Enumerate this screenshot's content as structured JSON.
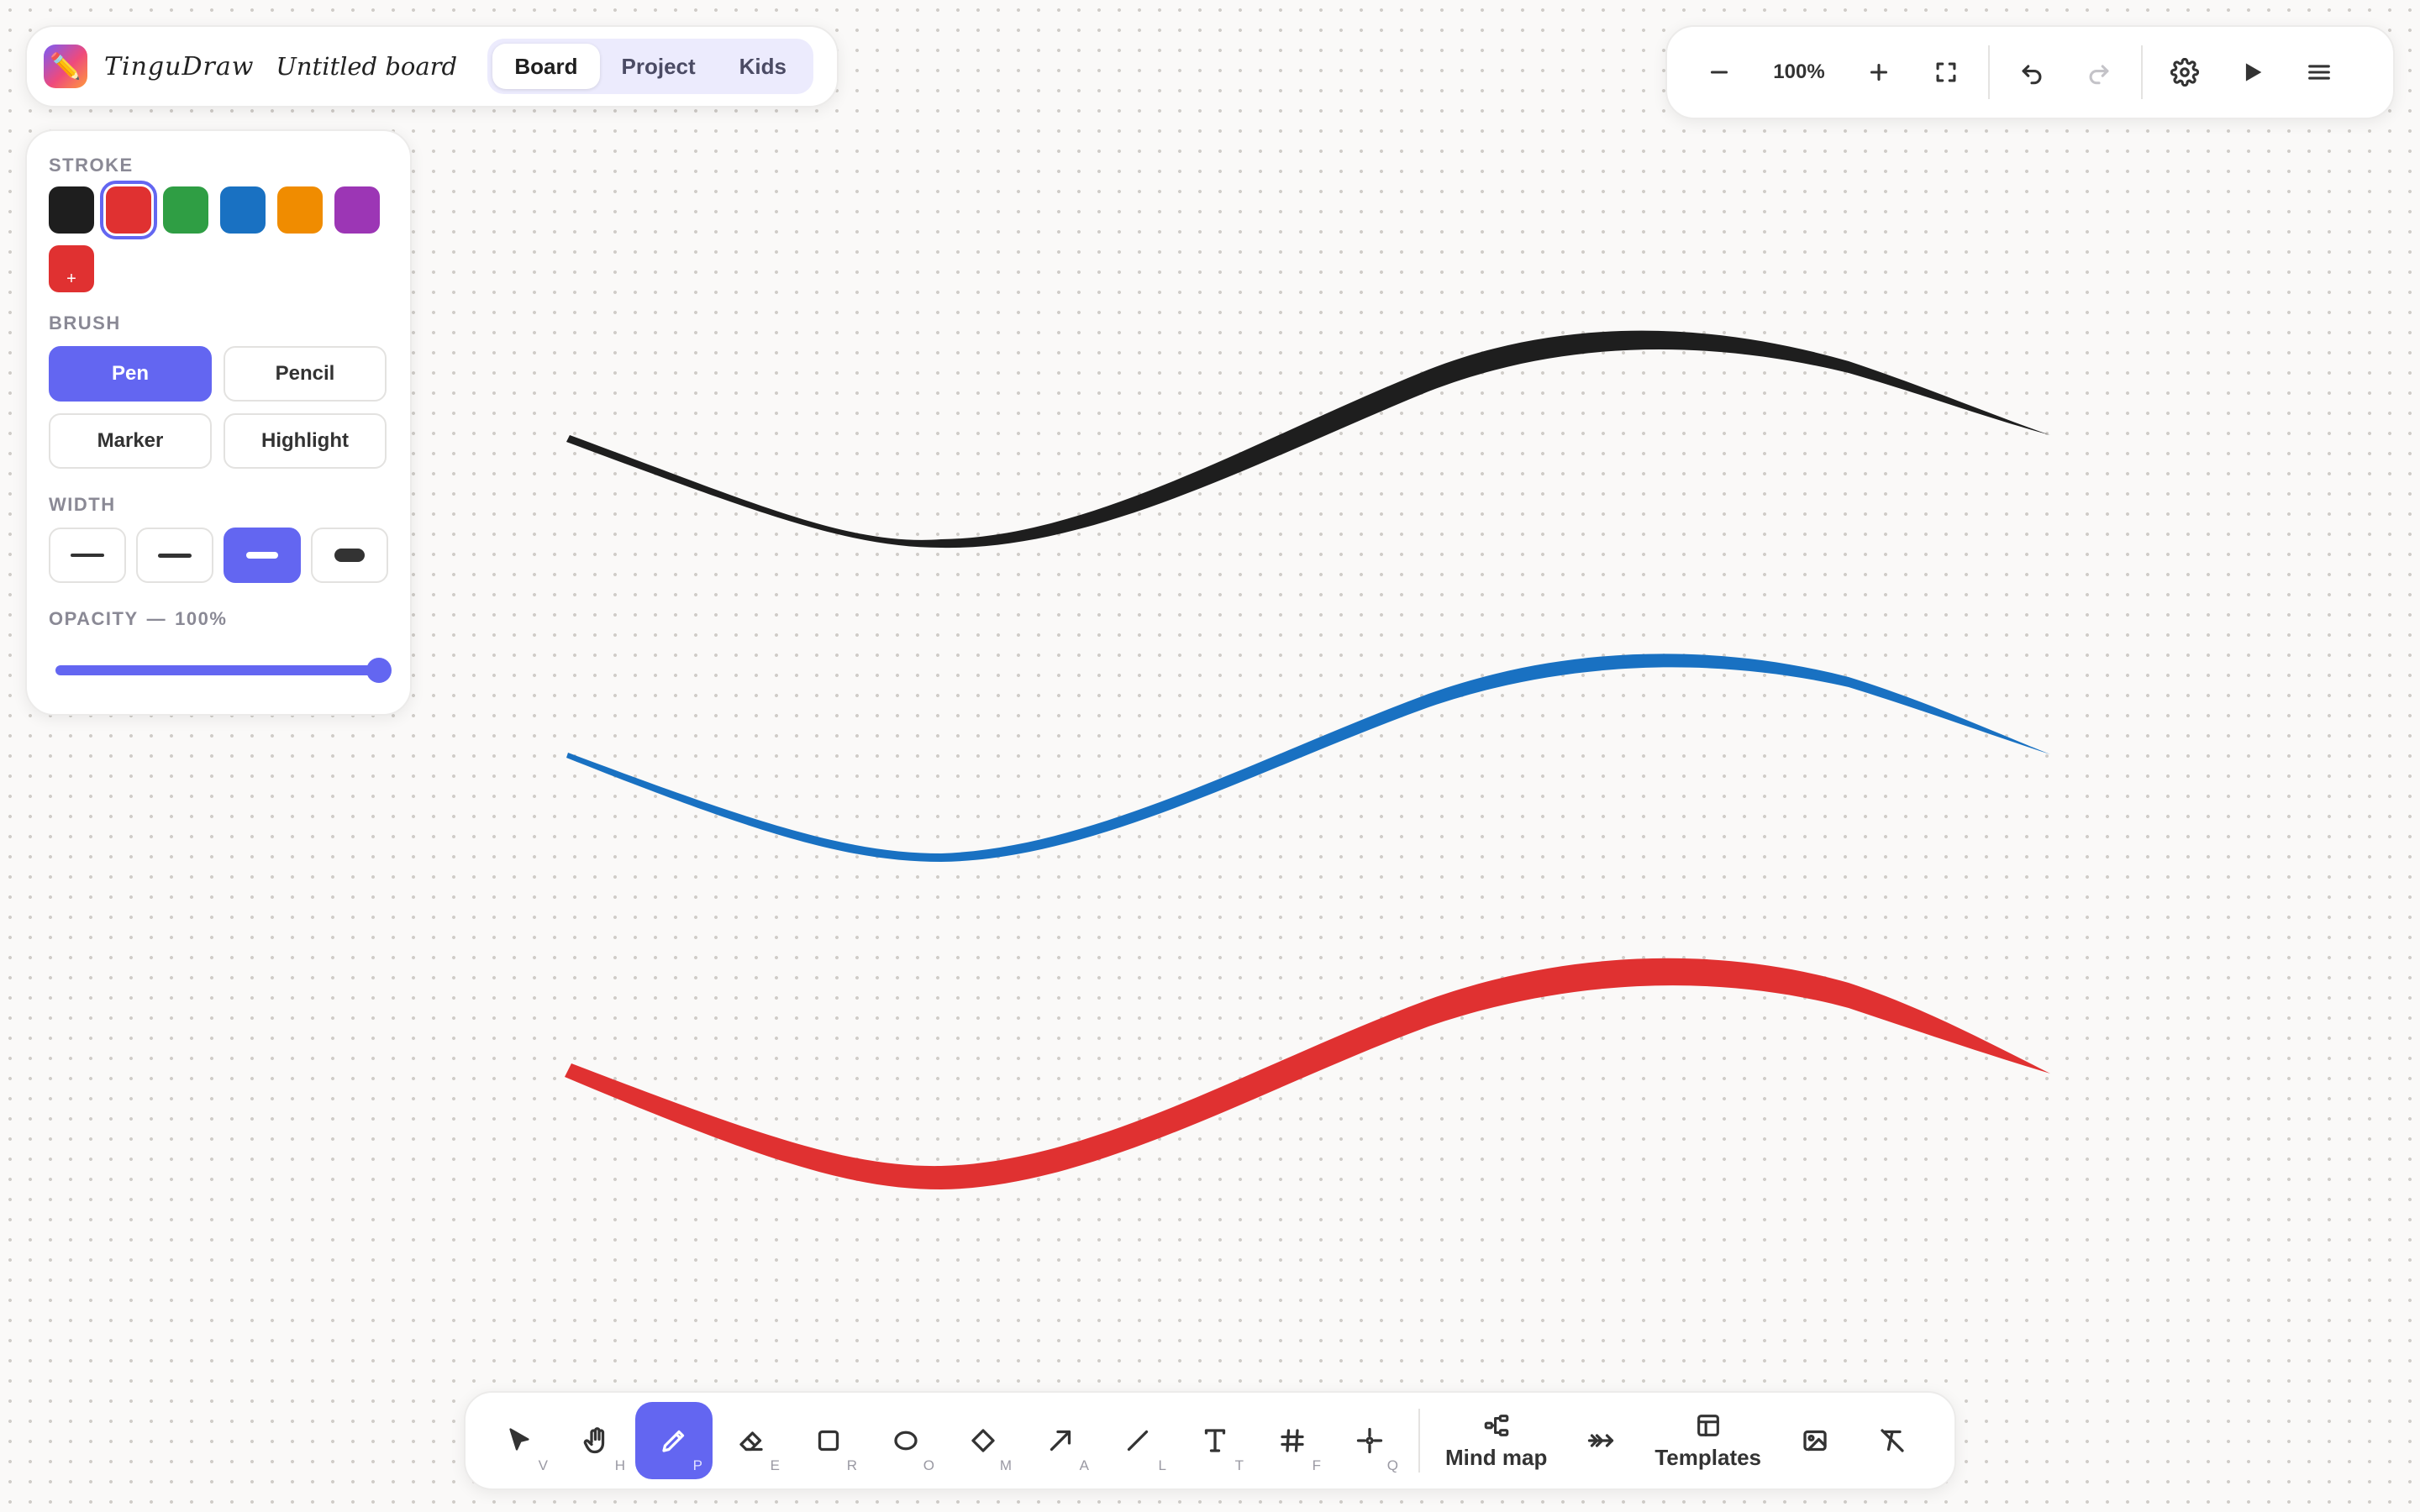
{
  "app": {
    "name": "TinguDraw",
    "board_name": "Untitled board",
    "logo_glyph": "✏️"
  },
  "mode_tabs": [
    {
      "label": "Board",
      "active": true
    },
    {
      "label": "Project",
      "active": false
    },
    {
      "label": "Kids",
      "active": false
    }
  ],
  "top_right": {
    "zoom": "100%"
  },
  "style_panel": {
    "stroke_label": "STROKE",
    "swatches": [
      {
        "color": "#1e1e1e"
      },
      {
        "color": "#e03131",
        "selected": true
      },
      {
        "color": "#2f9e44"
      },
      {
        "color": "#1971c2"
      },
      {
        "color": "#f08c00"
      },
      {
        "color": "#9c36b5"
      }
    ],
    "custom_swatch": {
      "color": "#e03131",
      "glyph": "+"
    },
    "brush_label": "BRUSH",
    "brushes": [
      {
        "label": "Pen",
        "active": true
      },
      {
        "label": "Pencil",
        "active": false
      },
      {
        "label": "Marker",
        "active": false
      },
      {
        "label": "Highlight",
        "active": false
      }
    ],
    "width_label": "WIDTH",
    "widths": [
      {
        "level": 1,
        "active": false
      },
      {
        "level": 2,
        "active": false
      },
      {
        "level": 3,
        "active": true
      },
      {
        "level": 4,
        "active": false
      }
    ],
    "opacity_label": "OPACITY",
    "opacity_sep": "—",
    "opacity_value": "100%",
    "opacity_fraction": 1.0
  },
  "strokes": [
    {
      "color": "#1e1e1e"
    },
    {
      "color": "#1971c2"
    },
    {
      "color": "#e03131"
    }
  ],
  "toolbar": {
    "tools": [
      {
        "name": "select",
        "hotkey": "V"
      },
      {
        "name": "hand",
        "hotkey": "H"
      },
      {
        "name": "pen",
        "hotkey": "P",
        "active": true
      },
      {
        "name": "eraser",
        "hotkey": "E"
      },
      {
        "name": "rectangle",
        "hotkey": "R"
      },
      {
        "name": "ellipse",
        "hotkey": "O"
      },
      {
        "name": "diamond",
        "hotkey": "M"
      },
      {
        "name": "arrow",
        "hotkey": "A"
      },
      {
        "name": "line",
        "hotkey": "L"
      },
      {
        "name": "text",
        "hotkey": "T"
      },
      {
        "name": "frame",
        "hotkey": "F"
      },
      {
        "name": "laser",
        "hotkey": "Q"
      }
    ],
    "mindmap_label": "Mind map",
    "templates_label": "Templates"
  }
}
